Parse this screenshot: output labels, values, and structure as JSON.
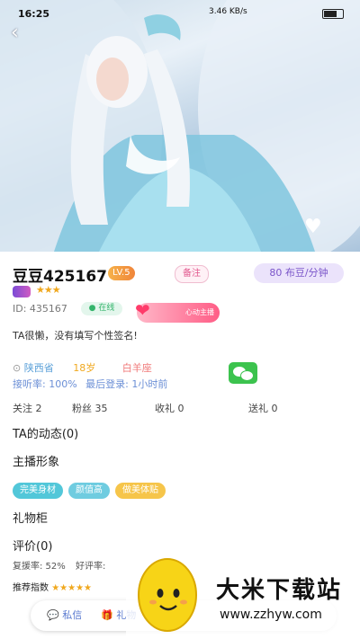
{
  "status_bar": {
    "time": "16:25",
    "network": "3.46 KB/s",
    "battery": "69"
  },
  "profile": {
    "name": "豆豆425167",
    "level": "LV.5",
    "follow_label": "备注",
    "price": "80 布豆/分钟",
    "id_text": "ID: 435167",
    "online": "在线",
    "medal": "心动主播",
    "signature": "TA很懒，没有填写个性签名!",
    "province": "陕西省",
    "age": "18岁",
    "zodiac": "白羊座",
    "answer_rate": "接听率: 100%",
    "last_login": "最后登录: 1小时前"
  },
  "stats": [
    {
      "label": "关注",
      "value": "2"
    },
    {
      "label": "粉丝",
      "value": "35"
    },
    {
      "label": "收礼",
      "value": "0"
    },
    {
      "label": "送礼",
      "value": "0"
    }
  ],
  "sections": {
    "dynamics": "TA的动态(0)",
    "image": "主播形象",
    "gifts": "礼物柜",
    "reviews": "评价(0)",
    "recommend": "推荐指数"
  },
  "tags": [
    {
      "label": "完美身材",
      "color": "#52c7d9"
    },
    {
      "label": "颜值高",
      "color": "#6fcce0"
    },
    {
      "label": "做美体贴",
      "color": "#f6c54a"
    }
  ],
  "review": {
    "reply_rate": "复援率: 52%",
    "praise_rate": "好评率:"
  },
  "bottom_bar": {
    "message": "私信",
    "gift": "礼物"
  },
  "watermark": {
    "title": "大米下载站",
    "url": "www.zzhyw.com"
  },
  "colors": {
    "accent_purple": "#7a55c9",
    "online_green": "#34b46b",
    "star": "#f0a81e"
  }
}
